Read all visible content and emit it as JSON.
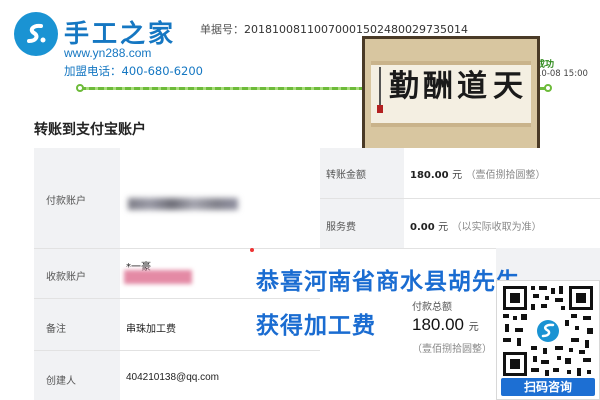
{
  "brand": {
    "name": "手工之家",
    "url": "www.yn288.com",
    "phone": "加盟电话：400-680-6200"
  },
  "order": {
    "label": "单据号：",
    "number": "20181008110070001502480029735014"
  },
  "progress": {
    "status": "成功",
    "time": "10-08 15:00"
  },
  "calligraphy": {
    "chars": [
      "天",
      "道",
      "酬",
      "勤"
    ]
  },
  "page_title": "转账到支付宝账户",
  "table": {
    "payer_label": "付款账户",
    "amount_label": "转账金额",
    "amount_value": "180.00",
    "amount_unit": "元",
    "amount_words": "（壹佰捌拾圆整）",
    "service_label": "服务费",
    "service_value": "0.00",
    "service_unit": "元",
    "service_note": "（以实际收取为准）",
    "payee_label": "收款账户",
    "payee_name": "*一豪",
    "remark_label": "备注",
    "remark_value": "串珠加工费",
    "total_label": "付款总额",
    "total_value": "180.00",
    "total_unit": "元",
    "total_words": "（壹佰捌拾圆整）",
    "creator_label": "创建人",
    "creator_value": "404210138@qq.com"
  },
  "banner": {
    "line1": "恭喜河南省商水县胡先生",
    "line2": "获得加工费"
  },
  "qr": {
    "button": "扫码咨询"
  },
  "colors": {
    "brand_blue": "#1577c2",
    "banner_blue": "#1a6cd1",
    "progress_green": "#6dbb3a",
    "qr_button": "#1d6fd3"
  }
}
